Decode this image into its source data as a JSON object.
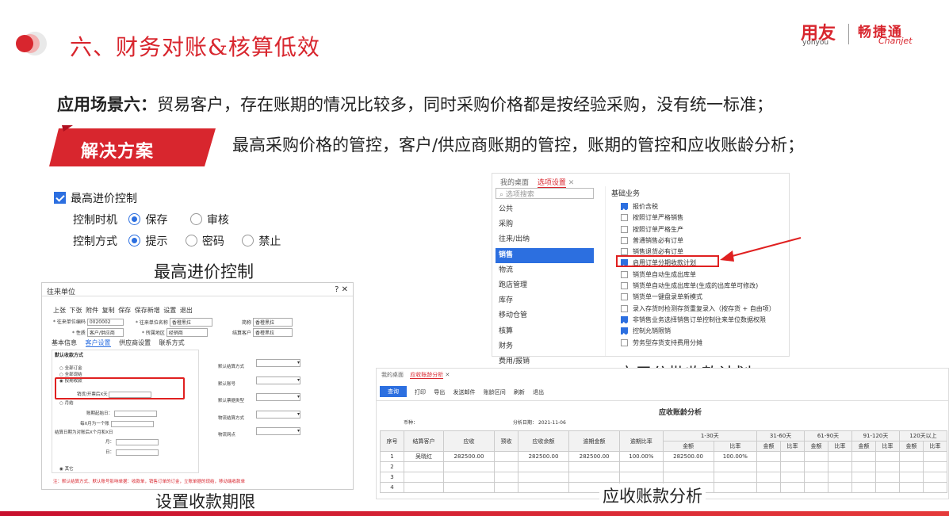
{
  "header": {
    "title": "六、财务对账&核算低效",
    "logo_main": "用友",
    "logo_sub": "yonyou",
    "logo_brand": "畅捷通",
    "logo_brand_en": "Chanjet"
  },
  "scene": {
    "label": "应用场景六：",
    "line1": "贸易客户，存在账期的情况比较多，同时采购价格都是按经验采购，没有统一标准；",
    "line2": "最高采购价格的管控，客户/供应商账期的管控，账期的管控和应收账龄分析；",
    "badge": "解决方案"
  },
  "price_panel": {
    "checkbox": "最高进价控制",
    "timing_label": "控制时机",
    "timing_opts": [
      "保存",
      "审核"
    ],
    "mode_label": "控制方式",
    "mode_opts": [
      "提示",
      "密码",
      "禁止"
    ],
    "caption": "最高进价控制"
  },
  "partner_win": {
    "title": "往来单位",
    "toolbar": [
      "上张",
      "下张",
      "附件",
      "复制",
      "保存",
      "保存新增",
      "设置",
      "退出"
    ],
    "f_code_l": "* 往来单位编码",
    "f_code_v": "0020002",
    "f_name_l": "* 往来单位名称",
    "f_name_v": "香橙黑拉",
    "f_abbr_l": "简称",
    "f_abbr_v": "香橙黑拉",
    "f_attr_l": "* 性质",
    "f_attr_v": "客户/供应商",
    "f_area_l": "* 所属地区",
    "f_area_v": "经销商",
    "f_settle_l": "结算客户",
    "f_settle_v": "香橙黑拉",
    "tabs": [
      "基本信息",
      "客户设置",
      "供应商设置",
      "联系方式"
    ],
    "group": "默认收款方式",
    "opts": [
      "全部订金",
      "全部现结",
      "按期收款",
      "月结",
      "其它"
    ],
    "days_label": "销货/开票后X天",
    "start_label": "账期起始日：",
    "month_label": "每X月为一个账",
    "day_label": "结算日期为对账后X个月和X日",
    "mo": "月：",
    "dd": "日：",
    "r_fields": [
      "默认结算方式",
      "默认账号",
      "默认票据类型",
      "物流结算方式",
      "物流网点"
    ],
    "note": "注：默认结算方式、默认账号影响单据：收款单，销售订单的订金，立账单据的现结，移动端收款单",
    "caption": "设置收款期限"
  },
  "options_win": {
    "tabs": [
      "我的桌面",
      "选项设置"
    ],
    "search": "选项搜索",
    "nav": [
      "公共",
      "采购",
      "往来/出纳",
      "销售",
      "物流",
      "跑店管理",
      "库存",
      "移动仓管",
      "核算",
      "财务",
      "费用/报销"
    ],
    "section": "基础业务",
    "items": [
      {
        "t": "报价含税",
        "on": true
      },
      {
        "t": "按照订单严格销售",
        "on": false
      },
      {
        "t": "按照订单严格生产",
        "on": false
      },
      {
        "t": "普通销售必有订单",
        "on": false
      },
      {
        "t": "销售退货必有订单",
        "on": false
      },
      {
        "t": "启用订单分期收款计划",
        "on": true
      },
      {
        "t": "销货单自动生成出库单",
        "on": false
      },
      {
        "t": "销货单自动生成出库单(生成的出库单可修改)",
        "on": false
      },
      {
        "t": "销货单一键盘录单新模式",
        "on": false
      },
      {
        "t": "录入存货时检测存货重复录入（按存货 + 自由项）",
        "on": false
      },
      {
        "t": "非销售业务选择销售订单控制往来单位数据权限",
        "on": true
      },
      {
        "t": "控制允销限销",
        "on": true
      },
      {
        "t": "劳务型存货支持费用分摊",
        "on": false
      }
    ],
    "caption": "启用分批收款计划"
  },
  "ar_win": {
    "tabs": [
      "我的桌面",
      "应收账龄分析"
    ],
    "query": "查询",
    "tools": [
      "打印",
      "导出",
      "发送邮件",
      "账龄区间",
      "刷新",
      "退出"
    ],
    "title": "应收账龄分析",
    "currency": "币种：",
    "date_label": "分析日期：",
    "date_val": "2021-11-06",
    "cols": [
      "序号",
      "结算客户",
      "应收",
      "预收",
      "应收余额",
      "逾期金额",
      "逾期比率"
    ],
    "ranges": [
      "1-30天",
      "31-60天",
      "61-90天",
      "91-120天",
      "120天以上"
    ],
    "sub": [
      "金额",
      "比率"
    ],
    "rows": [
      [
        "1",
        "吴晓红",
        "282500.00",
        "",
        "282500.00",
        "282500.00",
        "100.00%",
        "282500.00",
        "100.00%",
        "",
        "",
        "",
        "",
        "",
        "",
        "",
        ""
      ],
      [
        "2"
      ],
      [
        "3"
      ],
      [
        "4"
      ]
    ],
    "caption": "应收账款分析"
  }
}
